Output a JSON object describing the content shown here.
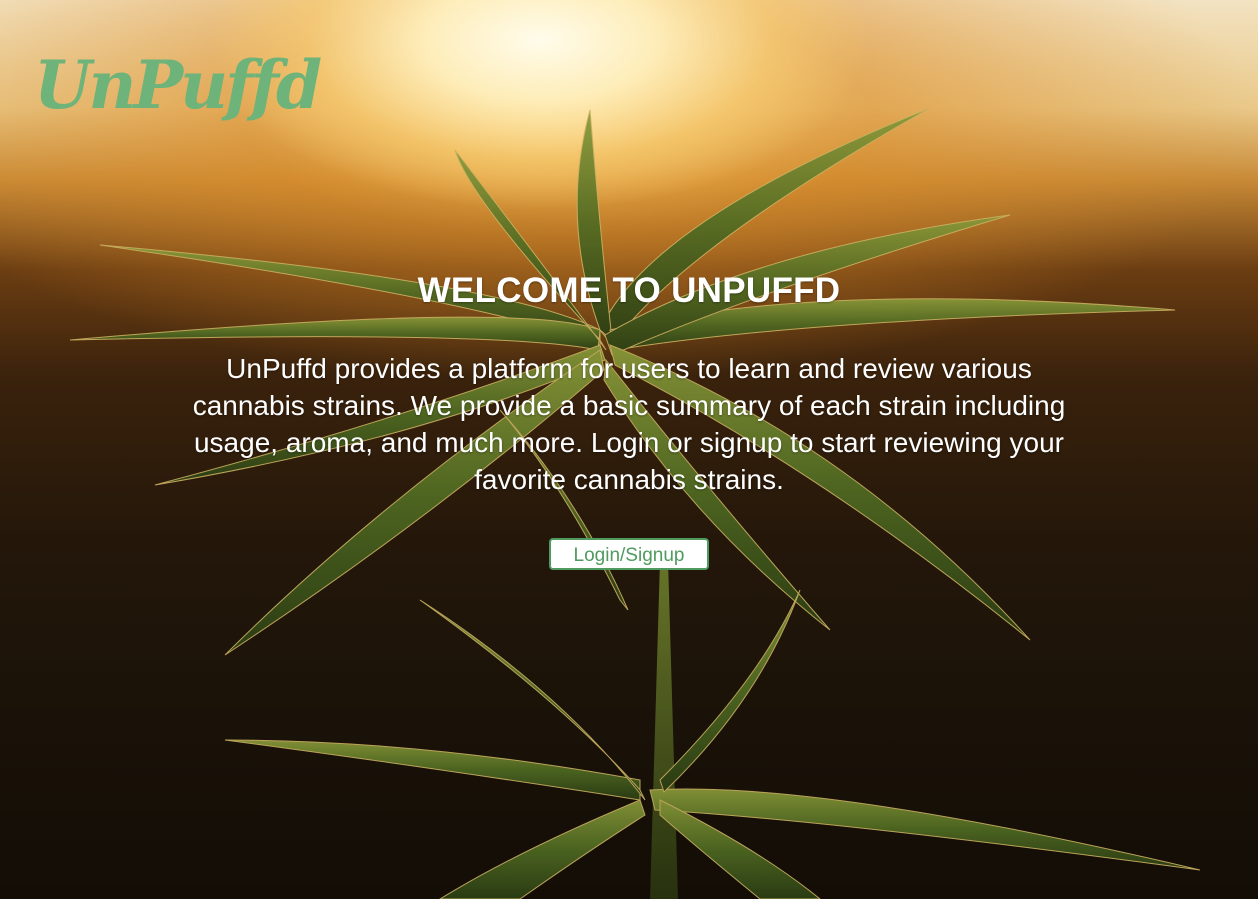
{
  "brand": {
    "logo_text": "UnPuffd",
    "accent_color": "#6db37a"
  },
  "hero": {
    "background_description_icon": "cannabis-plant-sunset-photo",
    "title": "WELCOME TO UNPUFFD",
    "description": "UnPuffd provides a platform for users to learn and review various cannabis strains. We provide a basic summary of each strain including usage, aroma, and much more. Login or signup to start reviewing your favorite cannabis strains.",
    "cta_label": "Login/Signup",
    "cta_color": "#4f9a5e"
  }
}
